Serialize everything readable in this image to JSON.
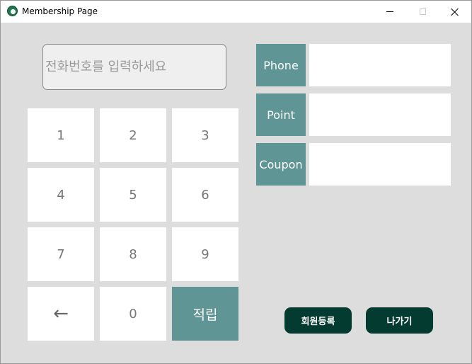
{
  "window": {
    "title": "Membership Page"
  },
  "phone_input": {
    "value": "",
    "placeholder": "전화번호를 입력하세요"
  },
  "keypad": {
    "keys": [
      "1",
      "2",
      "3",
      "4",
      "5",
      "6",
      "7",
      "8",
      "9",
      "←",
      "0",
      "적립"
    ]
  },
  "info": {
    "phone_label": "Phone",
    "phone_value": "",
    "point_label": "Point",
    "point_value": "",
    "coupon_label": "Coupon",
    "coupon_value": ""
  },
  "actions": {
    "register_label": "회원등록",
    "exit_label": "나가기"
  },
  "colors": {
    "background": "#dddddd",
    "accent": "#5f9595",
    "dark_button": "#033b30"
  }
}
